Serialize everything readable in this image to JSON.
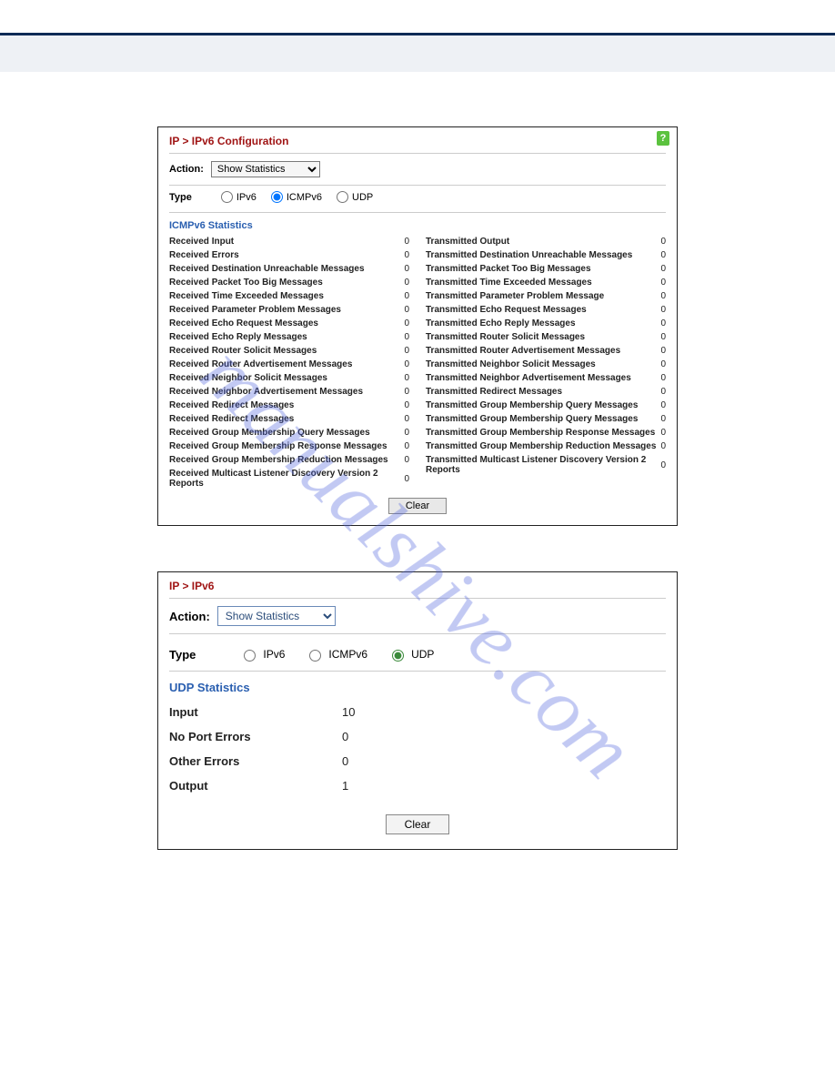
{
  "watermark": "manualshive.com",
  "panel1": {
    "title": "IP > IPv6 Configuration",
    "action_label": "Action:",
    "action_value": "Show Statistics",
    "type_label": "Type",
    "type_options": {
      "ipv6": "IPv6",
      "icmpv6": "ICMPv6",
      "udp": "UDP"
    },
    "type_selected": "icmpv6",
    "section_heading": "ICMPv6 Statistics",
    "clear_label": "Clear",
    "left_stats": [
      {
        "k": "Received Input",
        "v": "0"
      },
      {
        "k": "Received Errors",
        "v": "0"
      },
      {
        "k": "Received Destination Unreachable Messages",
        "v": "0"
      },
      {
        "k": "Received Packet Too Big Messages",
        "v": "0"
      },
      {
        "k": "Received Time Exceeded Messages",
        "v": "0"
      },
      {
        "k": "Received Parameter Problem Messages",
        "v": "0"
      },
      {
        "k": "Received Echo Request Messages",
        "v": "0"
      },
      {
        "k": "Received Echo Reply Messages",
        "v": "0"
      },
      {
        "k": "Received Router Solicit Messages",
        "v": "0"
      },
      {
        "k": "Received Router Advertisement Messages",
        "v": "0"
      },
      {
        "k": "Received Neighbor Solicit Messages",
        "v": "0"
      },
      {
        "k": "Received Neighbor Advertisement Messages",
        "v": "0"
      },
      {
        "k": "Received Redirect Messages",
        "v": "0"
      },
      {
        "k": "Received Redirect Messages",
        "v": "0"
      },
      {
        "k": "Received Group Membership Query Messages",
        "v": "0"
      },
      {
        "k": "Received Group Membership Response Messages",
        "v": "0"
      },
      {
        "k": "Received Group Membership Reduction Messages",
        "v": "0"
      },
      {
        "k": "Received Multicast Listener Discovery Version 2 Reports",
        "v": "0"
      }
    ],
    "right_stats": [
      {
        "k": "Transmitted Output",
        "v": "0"
      },
      {
        "k": "Transmitted Destination Unreachable Messages",
        "v": "0"
      },
      {
        "k": "Transmitted Packet Too Big Messages",
        "v": "0"
      },
      {
        "k": "Transmitted Time Exceeded Messages",
        "v": "0"
      },
      {
        "k": "Transmitted Parameter Problem Message",
        "v": "0"
      },
      {
        "k": "Transmitted Echo Request Messages",
        "v": "0"
      },
      {
        "k": "Transmitted Echo Reply Messages",
        "v": "0"
      },
      {
        "k": "Transmitted Router Solicit Messages",
        "v": "0"
      },
      {
        "k": "Transmitted Router Advertisement Messages",
        "v": "0"
      },
      {
        "k": "Transmitted Neighbor Solicit Messages",
        "v": "0"
      },
      {
        "k": "Transmitted Neighbor Advertisement Messages",
        "v": "0"
      },
      {
        "k": "Transmitted Redirect Messages",
        "v": "0"
      },
      {
        "k": "Transmitted Group Membership Query Messages",
        "v": "0"
      },
      {
        "k": "Transmitted Group Membership Query Messages",
        "v": "0"
      },
      {
        "k": "Transmitted Group Membership Response Messages",
        "v": "0"
      },
      {
        "k": "Transmitted Group Membership Reduction Messages",
        "v": "0"
      },
      {
        "k": "Transmitted Multicast Listener Discovery Version 2 Reports",
        "v": "0"
      }
    ]
  },
  "panel2": {
    "title": "IP > IPv6",
    "action_label": "Action:",
    "action_value": "Show Statistics",
    "type_label": "Type",
    "type_options": {
      "ipv6": "IPv6",
      "icmpv6": "ICMPv6",
      "udp": "UDP"
    },
    "type_selected": "udp",
    "section_heading": "UDP Statistics",
    "clear_label": "Clear",
    "stats": [
      {
        "k": "Input",
        "v": "10"
      },
      {
        "k": "No Port Errors",
        "v": "0"
      },
      {
        "k": "Other Errors",
        "v": "0"
      },
      {
        "k": "Output",
        "v": "1"
      }
    ]
  }
}
